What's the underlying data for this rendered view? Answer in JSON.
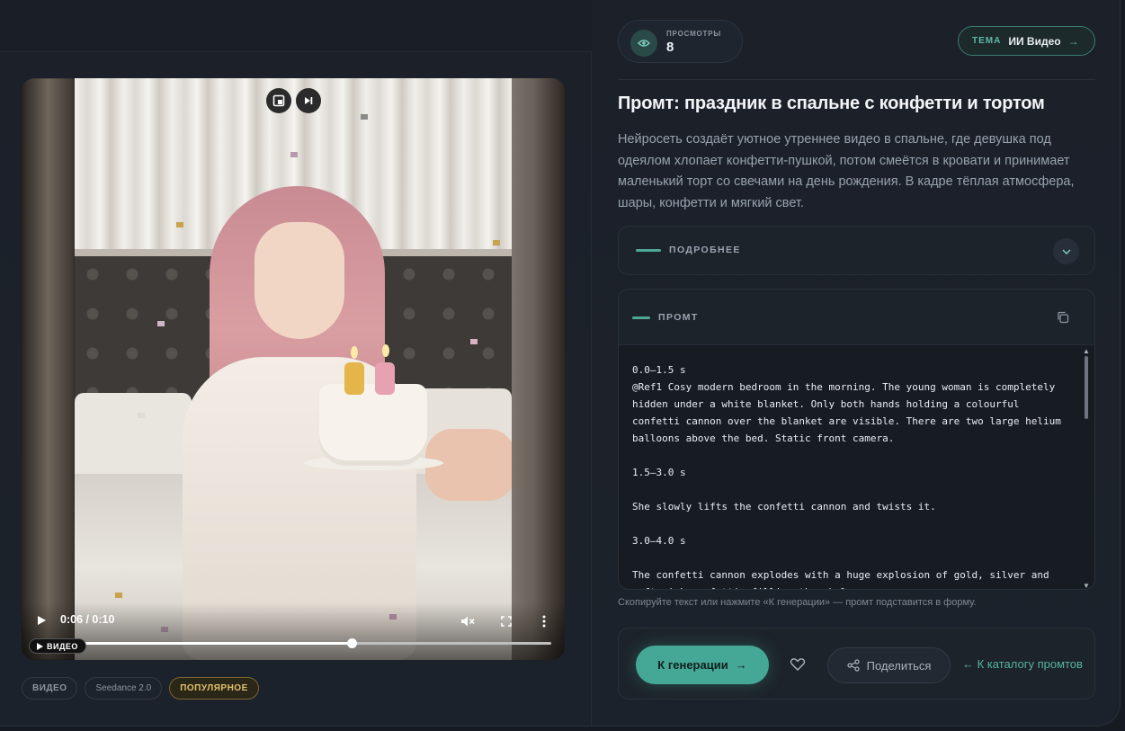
{
  "video": {
    "time_current": "0:06",
    "time_total": "0:10",
    "time_display": "0:06 / 0:10",
    "progress": 0.58,
    "badge": "ВИДЕО"
  },
  "tags": [
    {
      "label": "ВИДЕО"
    },
    {
      "label": "Seedance 2.0"
    },
    {
      "label": "ПОПУЛЯРНОЕ"
    }
  ],
  "views": {
    "label": "ПРОСМОТРЫ",
    "count": "8"
  },
  "theme": {
    "key": "ТЕМА",
    "value": "ИИ Видео",
    "arrow": "→"
  },
  "title": "Промт: праздник в спальне с конфетти и тортом",
  "description": "Нейросеть создаёт уютное утреннее видео в спальне, где девушка под одеялом хлопает конфетти-пушкой, потом смеётся в кровати и принимает маленький торт со свечами на день рождения. В кадре тёплая атмосфера, шары, конфетти и мягкий свет.",
  "details": {
    "label": "ПОДРОБНЕЕ"
  },
  "prompt": {
    "label": "ПРОМТ",
    "text": "0.0–1.5 s\n@Ref1 Cosy modern bedroom in the morning. The young woman is completely hidden under a white blanket. Only both hands holding a colourful confetti cannon over the blanket are visible. There are two large helium balloons above the bed. Static front camera.\n\n1.5–3.0 s\n\nShe slowly lifts the confetti cannon and twists it.\n\n3.0–4.0 s\n\nThe confetti cannon explodes with a huge explosion of gold, silver and soft pink confetti, filling the whole room."
  },
  "hint": "Скопируйте текст или нажмите «К генерации» — промт подставится в форму.",
  "actions": {
    "generate": "К генерации",
    "generate_arrow": "→",
    "share": "Поделиться",
    "catalog": "← К каталогу промтов"
  },
  "colors": {
    "accent": "#45a896",
    "gold": "#e2c36b",
    "background": "#1b2029"
  }
}
